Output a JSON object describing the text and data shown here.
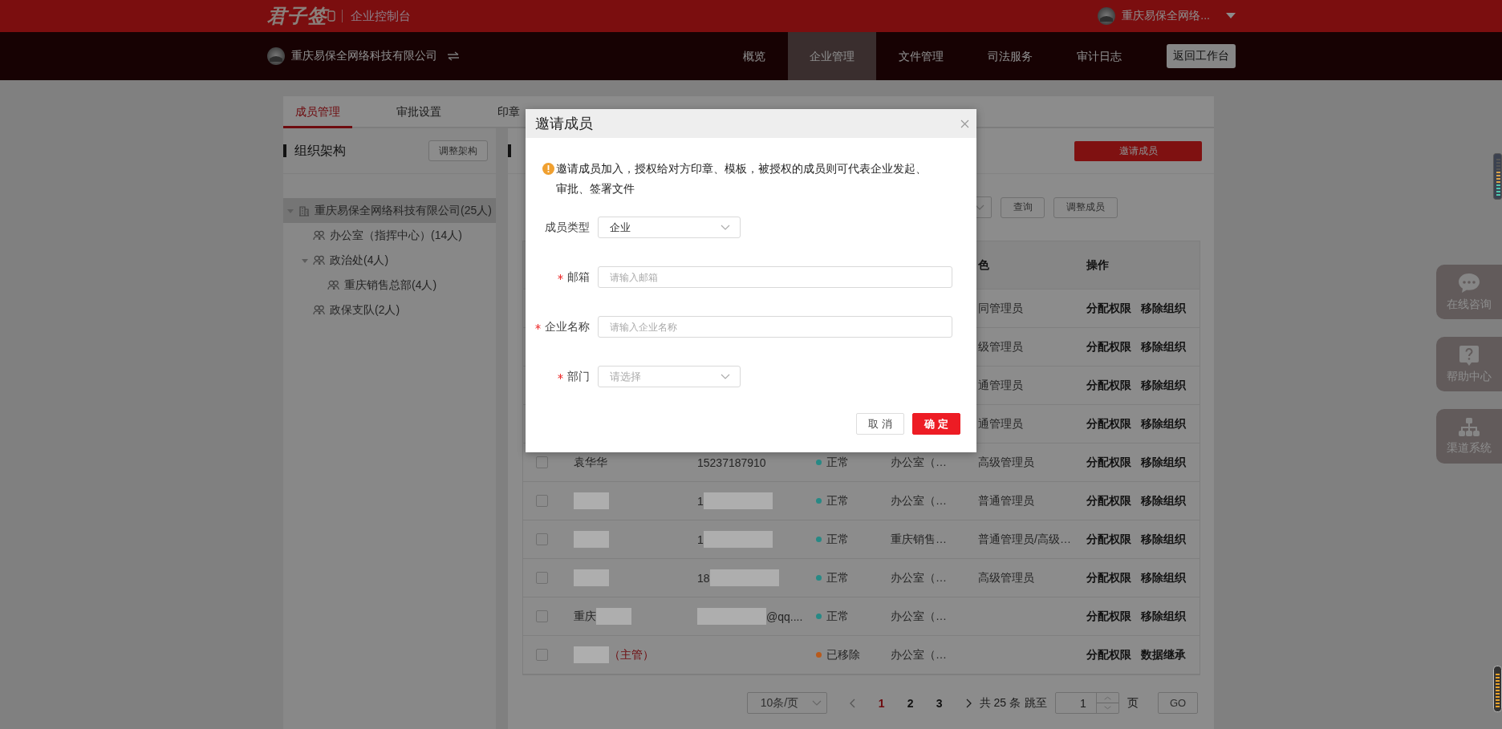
{
  "header": {
    "logo": "君子签",
    "console": "企业控制台",
    "account": "重庆易保全网络..."
  },
  "nav": {
    "company": "重庆易保全网络科技有限公司",
    "items": [
      {
        "label": "概览",
        "selected": false
      },
      {
        "label": "企业管理",
        "selected": true
      },
      {
        "label": "文件管理",
        "selected": false
      },
      {
        "label": "司法服务",
        "selected": false
      },
      {
        "label": "审计日志",
        "selected": false
      }
    ],
    "back_button": "返回工作台"
  },
  "tabs": [
    {
      "label": "成员管理",
      "selected": true
    },
    {
      "label": "审批设置",
      "selected": false
    },
    {
      "label": "印章",
      "selected": false
    }
  ],
  "org": {
    "title": "组织架构",
    "adjust_button": "调整架构",
    "tree": [
      {
        "label": "重庆易保全网络科技有限公司(25人)",
        "kind": "company",
        "selected": true,
        "expanded": true,
        "children": [
          {
            "label": "办公室（指挥中心）(14人)",
            "kind": "group",
            "selected": false
          },
          {
            "label": "政治处(4人)",
            "kind": "group",
            "selected": false,
            "expanded": true,
            "children": [
              {
                "label": "重庆销售总部(4人)",
                "kind": "group",
                "selected": false
              }
            ]
          },
          {
            "label": "政保支队(2人)",
            "kind": "group",
            "selected": false
          }
        ]
      }
    ]
  },
  "members": {
    "invite_button": "邀请成员",
    "query_button": "查询",
    "adjust_button": "调整成员",
    "columns": {
      "role": "色",
      "actions": "操作"
    },
    "rows": [
      {
        "role": "同管理员",
        "actions": [
          "分配权限",
          "移除组织"
        ]
      },
      {
        "role": "级管理员",
        "actions": [
          "分配权限",
          "移除组织"
        ]
      },
      {
        "role": "通管理员",
        "actions": [
          "分配权限",
          "移除组织"
        ]
      },
      {
        "role": "通管理员",
        "actions": [
          "分配权限",
          "移除组织"
        ]
      },
      {
        "checked": false,
        "name": [
          {
            "kind": "text",
            "text": "袁华华"
          }
        ],
        "phone": [
          {
            "kind": "text",
            "text": "15237187910"
          }
        ],
        "status": {
          "text": "正常",
          "color": "#278985"
        },
        "dept": "办公室（…",
        "role": "高级管理员",
        "actions": [
          "分配权限",
          "移除组织"
        ]
      },
      {
        "checked": false,
        "name": [
          {
            "kind": "mask"
          }
        ],
        "phone": [
          {
            "kind": "text",
            "text": "1"
          },
          {
            "kind": "mask"
          }
        ],
        "status": {
          "text": "正常",
          "color": "#278985"
        },
        "dept": "办公室（…",
        "role": "普通管理员",
        "actions": [
          "分配权限",
          "移除组织"
        ]
      },
      {
        "checked": false,
        "name": [
          {
            "kind": "mask"
          }
        ],
        "phone": [
          {
            "kind": "text",
            "text": "1"
          },
          {
            "kind": "mask"
          }
        ],
        "status": {
          "text": "正常",
          "color": "#278985"
        },
        "dept": "重庆销售…",
        "role": "普通管理员/高级…",
        "actions": [
          "分配权限",
          "移除组织"
        ]
      },
      {
        "checked": false,
        "name": [
          {
            "kind": "mask"
          }
        ],
        "phone": [
          {
            "kind": "text",
            "text": "18"
          },
          {
            "kind": "mask"
          }
        ],
        "status": {
          "text": "正常",
          "color": "#278985"
        },
        "dept": "办公室（…",
        "role": "高级管理员",
        "actions": [
          "分配权限",
          "移除组织"
        ]
      },
      {
        "checked": false,
        "name": [
          {
            "kind": "text",
            "text": "重庆"
          },
          {
            "kind": "mask"
          }
        ],
        "phone": [
          {
            "kind": "mask"
          },
          {
            "kind": "text",
            "text": "@qq...."
          }
        ],
        "status": {
          "text": "正常",
          "color": "#278985"
        },
        "dept": "办公室（…",
        "actions": [
          "分配权限",
          "移除组织"
        ]
      },
      {
        "checked": false,
        "name": [
          {
            "kind": "mask"
          },
          {
            "kind": "tag",
            "text": "（主管）"
          }
        ],
        "status": {
          "text": "已移除",
          "color": "#b85a1c"
        },
        "dept": "办公室（…",
        "actions": [
          "分配权限",
          "数据继承"
        ]
      }
    ],
    "pagination": {
      "page_size": "10条/页",
      "pages": [
        {
          "label": "1",
          "selected": true
        },
        {
          "label": "2",
          "selected": false
        },
        {
          "label": "3",
          "selected": false
        }
      ],
      "total": "共 25 条",
      "jump_label": "跳至",
      "jump_value": "1",
      "page_unit": "页",
      "go_button": "GO"
    }
  },
  "float_tools": [
    {
      "label": "在线咨询",
      "kind": "chat"
    },
    {
      "label": "帮助中心",
      "kind": "help"
    },
    {
      "label": "渠道系统",
      "kind": "network"
    }
  ],
  "dialog": {
    "title": "邀请成员",
    "notice": "邀请成员加入，授权给对方印章、模板，被授权的成员则可代表企业发起、审批、签署文件",
    "fields": [
      {
        "kind": "select",
        "label": "成员类型",
        "required": false,
        "value": "企业"
      },
      {
        "kind": "input",
        "label": "邮箱",
        "required": true,
        "placeholder": "请输入邮箱"
      },
      {
        "kind": "input",
        "label": "企业名称",
        "required": true,
        "placeholder": "请输入企业名称"
      },
      {
        "kind": "select",
        "label": "部门",
        "required": true,
        "placeholder": "请选择"
      }
    ],
    "cancel_button": "取 消",
    "ok_button": "确 定"
  }
}
